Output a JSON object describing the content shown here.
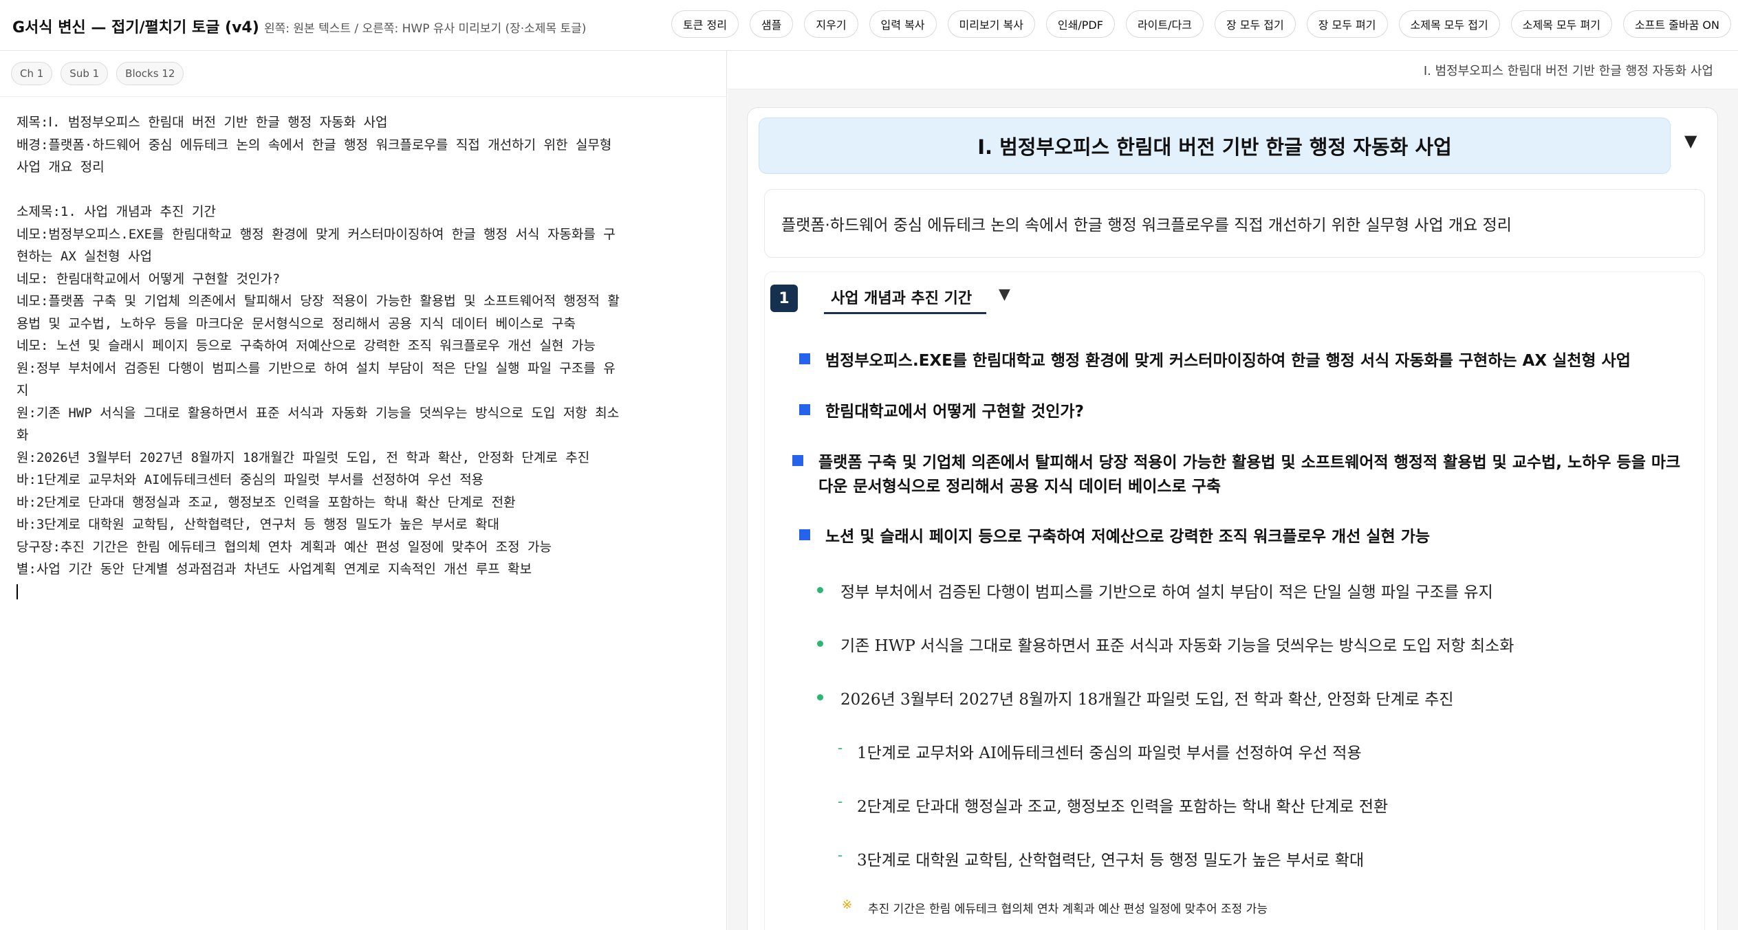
{
  "app": {
    "title": "G서식 변신 — 접기/펼치기 토글 (v4)",
    "subtitle": "왼쪽: 원본 텍스트 / 오른쪽: HWP 유사 미리보기 (장·소제목 토글)"
  },
  "toolbar": {
    "buttons": [
      {
        "name": "token-cleanup-button",
        "label": "토큰 정리"
      },
      {
        "name": "sample-button",
        "label": "샘플"
      },
      {
        "name": "clear-button",
        "label": "지우기"
      },
      {
        "name": "copy-input-button",
        "label": "입력 복사"
      },
      {
        "name": "copy-preview-button",
        "label": "미리보기 복사"
      },
      {
        "name": "print-pdf-button",
        "label": "인쇄/PDF"
      },
      {
        "name": "theme-toggle-button",
        "label": "라이트/다크"
      },
      {
        "name": "collapse-all-chapters-button",
        "label": "장 모두 접기"
      },
      {
        "name": "expand-all-chapters-button",
        "label": "장 모두 펴기"
      },
      {
        "name": "collapse-all-subtitles-button",
        "label": "소제목 모두 접기"
      },
      {
        "name": "expand-all-subtitles-button",
        "label": "소제목 모두 펴기"
      },
      {
        "name": "soft-wrap-toggle-button",
        "label": "소프트 줄바꿈 ON"
      }
    ]
  },
  "stats": {
    "ch": "Ch 1",
    "sub": "Sub 1",
    "blocks": "Blocks 12"
  },
  "editor": {
    "lines": [
      "제목:Ⅰ. 범정부오피스 한림대 버전 기반 한글 행정 자동화 사업",
      "배경:플랫폼·하드웨어 중심 에듀테크 논의 속에서 한글 행정 워크플로우를 직접 개선하기 위한 실무형",
      "사업 개요 정리",
      "",
      "소제목:1. 사업 개념과 추진 기간",
      "네모:범정부오피스.EXE를 한림대학교 행정 환경에 맞게 커스터마이징하여 한글 행정 서식 자동화를 구",
      "현하는 AX 실천형 사업",
      "네모: 한림대학교에서 어떻게 구현할 것인가?",
      "네모:플랫폼 구축 및 기업체 의존에서 탈피해서 당장 적용이 가능한 활용법 및 소프트웨어적 행정적 활",
      "용법 및 교수법, 노하우 등을 마크다운 문서형식으로 정리해서 공용 지식 데이터 베이스로 구축",
      "네모: 노션 및 슬래시 페이지 등으로 구축하여 저예산으로 강력한 조직 워크플로우 개선 실현 가능",
      "원:정부 부처에서 검증된 다행이 범피스를 기반으로 하여 설치 부담이 적은 단일 실행 파일 구조를 유",
      "지",
      "원:기존 HWP 서식을 그대로 활용하면서 표준 서식과 자동화 기능을 덧씌우는 방식으로 도입 저항 최소",
      "화",
      "원:2026년 3월부터 2027년 8월까지 18개월간 파일럿 도입, 전 학과 확산, 안정화 단계로 추진",
      "바:1단계로 교무처와 AI에듀테크센터 중심의 파일럿 부서를 선정하여 우선 적용",
      "바:2단계로 단과대 행정실과 조교, 행정보조 인력을 포함하는 학내 확산 단계로 전환",
      "바:3단계로 대학원 교학팀, 산학협력단, 연구처 등 행정 밀도가 높은 부서로 확대",
      "당구장:추진 기간은 한림 에듀테크 협의체 연차 계획과 예산 편성 일정에 맞추어 조정 가능",
      "별:사업 기간 동안 단계별 성과점검과 차년도 사업계획 연계로 지속적인 개선 루프 확보"
    ]
  },
  "preview": {
    "breadcrumb": "Ⅰ. 범정부오피스 한림대 버전 기반 한글 행정 자동화 사업",
    "chapter_title": "Ⅰ. 범정부오피스 한림대 버전 기반 한글 행정 자동화 사업",
    "chapter_toggle": "▼",
    "background": "플랫폼·하드웨어 중심 에듀테크 논의 속에서 한글 행정 워크플로우를 직접 개선하기 위한 실무형 사업 개요 정리",
    "section": {
      "number": "1",
      "title": "사업 개념과 추진 기간",
      "toggle": "▼"
    },
    "nemo": [
      "범정부오피스.EXE를 한림대학교 행정 환경에 맞게 커스터마이징하여 한글 행정 서식 자동화를 구현하는 AX 실천형 사업",
      "한림대학교에서 어떻게 구현할 것인가?",
      "플랫폼 구축 및 기업체 의존에서 탈피해서 당장 적용이 가능한 활용법 및 소프트웨어적 행정적 활용법 및 교수법, 노하우 등을 마크다운 문서형식으로 정리해서 공용 지식 데이터 베이스로 구축",
      "노션 및 슬래시 페이지 등으로 구축하여 저예산으로 강력한 조직 워크플로우 개선 실현 가능"
    ],
    "won": [
      "정부 부처에서 검증된 다행이 범피스를 기반으로 하여 설치 부담이 적은 단일 실행 파일 구조를 유지",
      "기존 HWP 서식을 그대로 활용하면서 표준 서식과 자동화 기능을 덧씌우는 방식으로 도입 저항 최소화",
      "2026년 3월부터 2027년 8월까지 18개월간 파일럿 도입, 전 학과 확산, 안정화 단계로 추진"
    ],
    "ba_marker": "-",
    "ba": [
      "1단계로 교무처와 AI에듀테크센터 중심의 파일럿 부서를 선정하여 우선 적용",
      "2단계로 단과대 행정실과 조교, 행정보조 인력을 포함하는 학내 확산 단계로 전환",
      "3단계로 대학원 교학팀, 산학협력단, 연구처 등 행정 밀도가 높은 부서로 확대"
    ],
    "dang_marker": "※",
    "dang": "추진 기간은 한림 에듀테크 협의체 연차 계획과 예산 편성 일정에 맞추어 조정 가능"
  }
}
